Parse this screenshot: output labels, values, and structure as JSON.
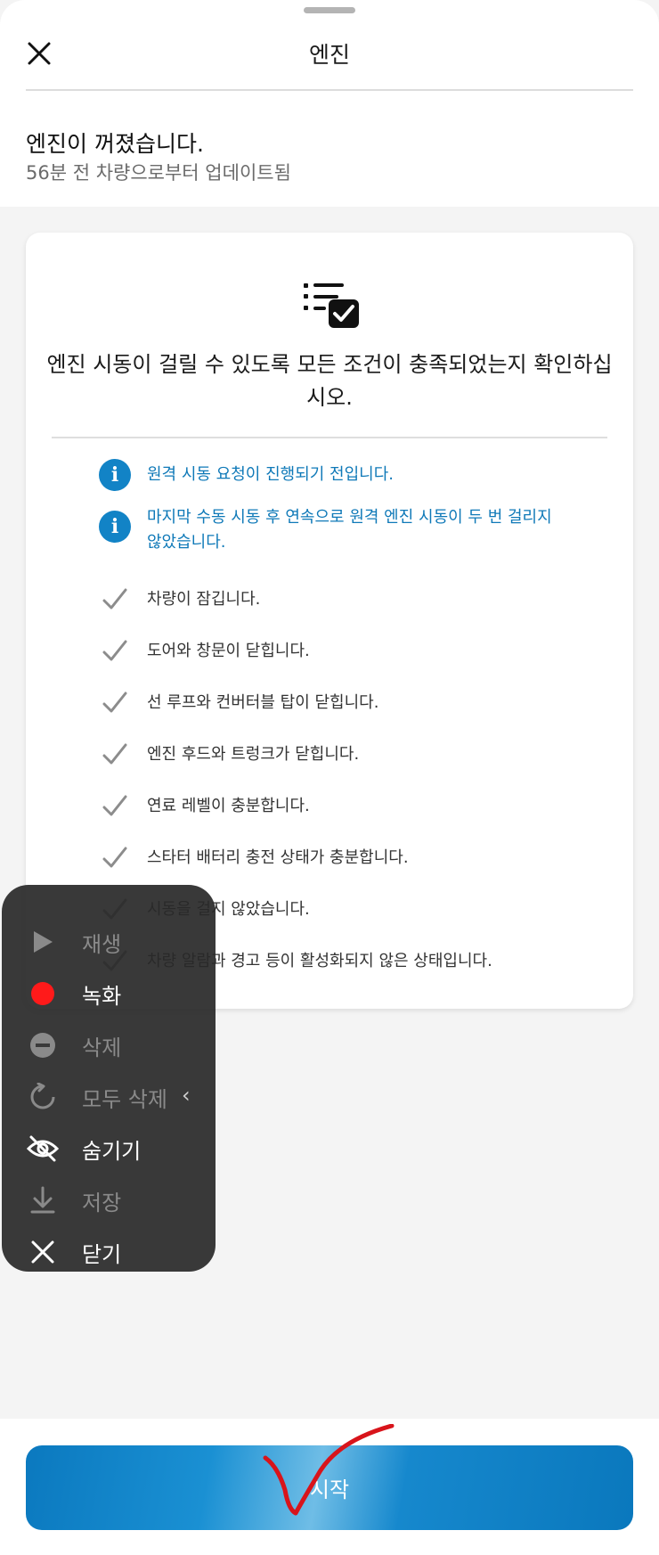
{
  "header": {
    "title": "엔진"
  },
  "status": {
    "main": "엔진이 꺼졌습니다.",
    "sub": "56분 전 차량으로부터 업데이트됨"
  },
  "card": {
    "title": "엔진 시동이 걸릴 수 있도록 모든 조건이 충족되었는지 확인하십시오.",
    "conditions": [
      {
        "type": "info",
        "text": "원격 시동 요청이 진행되기 전입니다."
      },
      {
        "type": "info",
        "text": "마지막 수동 시동 후 연속으로 원격 엔진 시동이 두 번 걸리지 않았습니다."
      },
      {
        "type": "check",
        "text": "차량이 잠깁니다."
      },
      {
        "type": "check",
        "text": "도어와 창문이 닫힙니다."
      },
      {
        "type": "check",
        "text": "선 루프와 컨버터블 탑이 닫힙니다."
      },
      {
        "type": "check",
        "text": "엔진 후드와 트렁크가 닫힙니다."
      },
      {
        "type": "check",
        "text": "연료 레벨이 충분합니다."
      },
      {
        "type": "check",
        "text": "스타터 배터리 충전 상태가 충분합니다."
      },
      {
        "type": "check",
        "text": "시동을 걸지 않았습니다."
      },
      {
        "type": "check",
        "text": "차량 알람과 경고 등이 활성화되지 않은 상태입니다."
      }
    ]
  },
  "overlay_menu": {
    "items": [
      {
        "label": "재생",
        "icon": "play-icon",
        "enabled": false
      },
      {
        "label": "녹화",
        "icon": "record-icon",
        "enabled": true
      },
      {
        "label": "삭제",
        "icon": "minus-circle-icon",
        "enabled": false
      },
      {
        "label": "모두 삭제",
        "icon": "refresh-icon",
        "enabled": false
      },
      {
        "label": "숨기기",
        "icon": "eye-off-icon",
        "enabled": true
      },
      {
        "label": "저장",
        "icon": "download-icon",
        "enabled": false
      },
      {
        "label": "닫기",
        "icon": "close-icon",
        "enabled": true
      }
    ],
    "expand_glyph": "‹"
  },
  "footer": {
    "start_label": "시작"
  },
  "colors": {
    "accent": "#0b79bf",
    "info": "#1283c6",
    "check": "#8c8c8c",
    "record": "#ff1a1a",
    "annotation": "#d8141b"
  }
}
